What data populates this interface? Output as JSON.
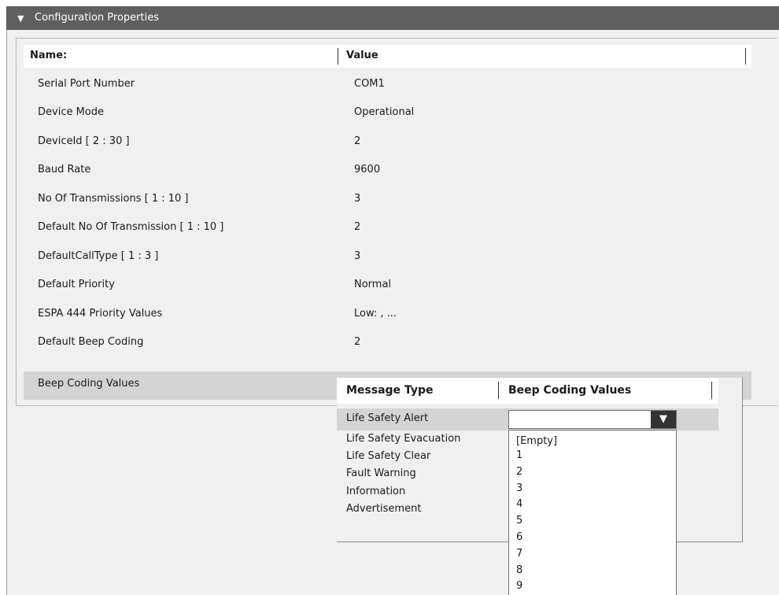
{
  "header": {
    "title": "Configuration Properties"
  },
  "grid": {
    "col_name": "Name:",
    "col_value": "Value",
    "rows": [
      {
        "name": "Serial Port Number",
        "value": "COM1"
      },
      {
        "name": "Device Mode",
        "value": "Operational"
      },
      {
        "name": "DeviceId [ 2 : 30 ]",
        "value": "2"
      },
      {
        "name": "Baud Rate",
        "value": "9600"
      },
      {
        "name": "No Of Transmissions [ 1 : 10 ]",
        "value": "3"
      },
      {
        "name": "Default No Of Transmission [ 1 : 10 ]",
        "value": "2"
      },
      {
        "name": "DefaultCallType [ 1 : 3 ]",
        "value": "3"
      },
      {
        "name": "Default Priority",
        "value": "Normal"
      },
      {
        "name": "ESPA 444 Priority Values",
        "value": "Low: , ..."
      },
      {
        "name": "Default Beep Coding",
        "value": "2"
      },
      {
        "name": "Beep Coding Values",
        "value": ""
      }
    ]
  },
  "subgrid": {
    "col_message": "Message Type",
    "col_values": "Beep Coding Values",
    "messages": [
      "Life Safety Alert",
      "Life Safety Evacuation",
      "Life Safety Clear",
      "Fault Warning",
      "Information",
      "Advertisement"
    ],
    "selected_value": ""
  },
  "dropdown": {
    "options": [
      "[Empty]",
      "1",
      "2",
      "3",
      "4",
      "5",
      "6",
      "7",
      "8",
      "9"
    ]
  }
}
